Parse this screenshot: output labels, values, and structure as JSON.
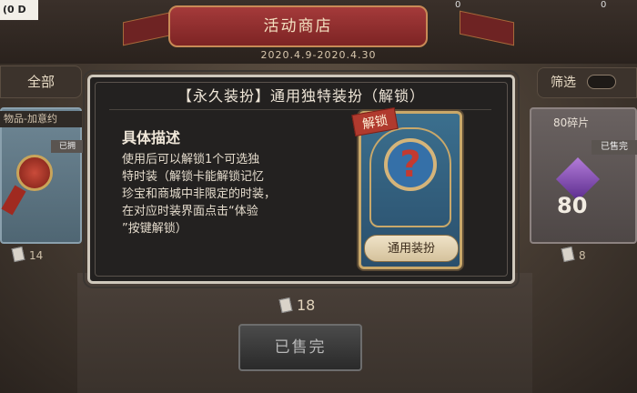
{
  "corner_label": "(0 D",
  "top_counters": {
    "left": "0",
    "right": "0"
  },
  "banner": {
    "title": "活动商店",
    "date_range": "2020.4.9-2020.4.30"
  },
  "tabs": {
    "all": "全部",
    "filter": "筛选"
  },
  "left_card": {
    "label": "物品-加意约",
    "status": "已拥",
    "price": "14"
  },
  "right_card": {
    "label": "80碎片",
    "status": "已售完",
    "shard_count": "80",
    "price": "8"
  },
  "popup": {
    "title": "【永久装扮】通用独特装扮（解锁）",
    "desc_heading": "具体描述",
    "desc_body": "使用后可以解锁1个可选独\n特时装（解锁卡能解锁记忆\n珍宝和商城中非限定的时装，\n在对应时装界面点击“体验\n”按键解锁）",
    "card_tag": "解锁",
    "card_caption": "通用装扮"
  },
  "main_price": "18",
  "sold_button": "已售完",
  "colors": {
    "banner_red": "#a43a3a",
    "gold_border": "#c9a86a",
    "unlock_red": "#b03a2e"
  }
}
